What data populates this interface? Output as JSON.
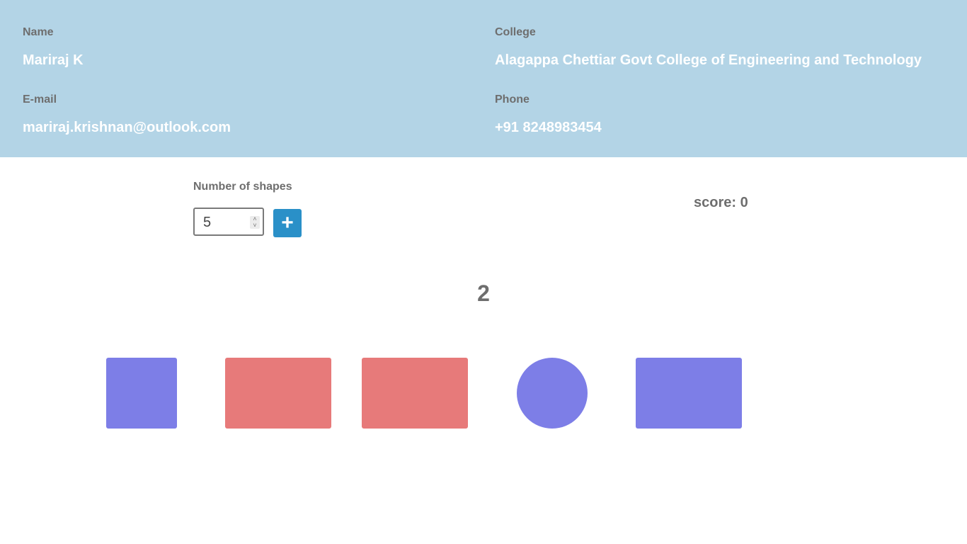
{
  "profile": {
    "name_label": "Name",
    "name_value": "Mariraj K",
    "college_label": "College",
    "college_value": "Alagappa Chettiar Govt College of Engineering and Technology",
    "email_label": "E-mail",
    "email_value": "mariraj.krishnan@outlook.com",
    "phone_label": "Phone",
    "phone_value": "+91 8248983454"
  },
  "controls": {
    "shapes_label": "Number of shapes",
    "shapes_count": "5",
    "add_icon": "plus-icon"
  },
  "score_text": "score: 0",
  "target_number": "2",
  "shapes": [
    {
      "type": "square",
      "color": "#7d7ee7"
    },
    {
      "type": "rectangle",
      "color": "#e77a7a"
    },
    {
      "type": "rectangle",
      "color": "#e77a7a"
    },
    {
      "type": "circle",
      "color": "#7d7ee7"
    },
    {
      "type": "rectangle",
      "color": "#7d7ee7"
    }
  ],
  "colors": {
    "header_bg": "#b3d4e6",
    "button_bg": "#2a90c8",
    "blue_shape": "#7d7ee7",
    "red_shape": "#e77a7a"
  }
}
